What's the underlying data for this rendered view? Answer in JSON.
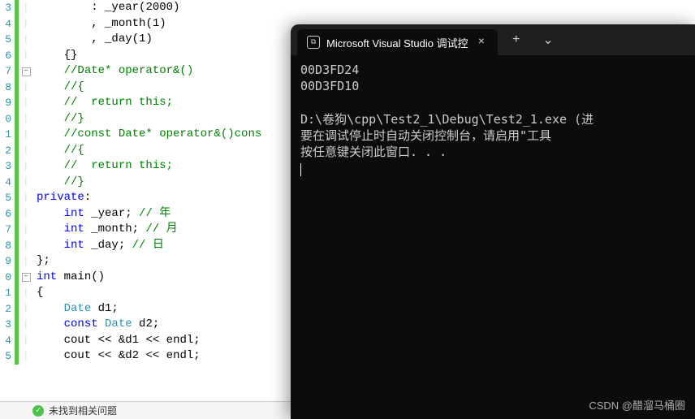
{
  "editor": {
    "lines": [
      {
        "num": "3",
        "fold": "",
        "code": [
          {
            "cls": "c-text",
            "t": "        "
          },
          {
            "cls": "c-punc",
            "t": ": "
          },
          {
            "cls": "c-text",
            "t": "_year"
          },
          {
            "cls": "c-punc",
            "t": "("
          },
          {
            "cls": "c-num",
            "t": "2000"
          },
          {
            "cls": "c-punc",
            "t": ")"
          }
        ]
      },
      {
        "num": "4",
        "fold": "",
        "code": [
          {
            "cls": "c-text",
            "t": "        "
          },
          {
            "cls": "c-punc",
            "t": ", "
          },
          {
            "cls": "c-text",
            "t": "_month"
          },
          {
            "cls": "c-punc",
            "t": "("
          },
          {
            "cls": "c-num",
            "t": "1"
          },
          {
            "cls": "c-punc",
            "t": ")"
          }
        ]
      },
      {
        "num": "5",
        "fold": "",
        "code": [
          {
            "cls": "c-text",
            "t": "        "
          },
          {
            "cls": "c-punc",
            "t": ", "
          },
          {
            "cls": "c-text",
            "t": "_day"
          },
          {
            "cls": "c-punc",
            "t": "("
          },
          {
            "cls": "c-num",
            "t": "1"
          },
          {
            "cls": "c-punc",
            "t": ")"
          }
        ]
      },
      {
        "num": "6",
        "fold": "",
        "code": [
          {
            "cls": "c-text",
            "t": "    "
          },
          {
            "cls": "c-punc",
            "t": "{}"
          }
        ]
      },
      {
        "num": "7",
        "fold": "box",
        "code": [
          {
            "cls": "c-text",
            "t": "    "
          },
          {
            "cls": "c-comment",
            "t": "//Date* operator&()"
          }
        ]
      },
      {
        "num": "8",
        "fold": "",
        "code": [
          {
            "cls": "c-text",
            "t": "    "
          },
          {
            "cls": "c-comment",
            "t": "//{"
          }
        ]
      },
      {
        "num": "9",
        "fold": "",
        "code": [
          {
            "cls": "c-text",
            "t": "    "
          },
          {
            "cls": "c-comment",
            "t": "//  return this;"
          }
        ]
      },
      {
        "num": "0",
        "fold": "",
        "code": [
          {
            "cls": "c-text",
            "t": "    "
          },
          {
            "cls": "c-comment",
            "t": "//}"
          }
        ]
      },
      {
        "num": "1",
        "fold": "",
        "code": [
          {
            "cls": "c-text",
            "t": "    "
          },
          {
            "cls": "c-comment",
            "t": "//const Date* operator&()cons"
          }
        ]
      },
      {
        "num": "2",
        "fold": "",
        "code": [
          {
            "cls": "c-text",
            "t": "    "
          },
          {
            "cls": "c-comment",
            "t": "//{"
          }
        ]
      },
      {
        "num": "3",
        "fold": "",
        "code": [
          {
            "cls": "c-text",
            "t": "    "
          },
          {
            "cls": "c-comment",
            "t": "//  return this;"
          }
        ]
      },
      {
        "num": "4",
        "fold": "",
        "code": [
          {
            "cls": "c-text",
            "t": "    "
          },
          {
            "cls": "c-comment",
            "t": "//}"
          }
        ]
      },
      {
        "num": "5",
        "fold": "",
        "code": [
          {
            "cls": "c-keyword",
            "t": "private"
          },
          {
            "cls": "c-punc",
            "t": ":"
          }
        ]
      },
      {
        "num": "6",
        "fold": "",
        "code": [
          {
            "cls": "c-text",
            "t": "    "
          },
          {
            "cls": "c-keyword",
            "t": "int"
          },
          {
            "cls": "c-text",
            "t": " _year; "
          },
          {
            "cls": "c-comment",
            "t": "// 年"
          }
        ]
      },
      {
        "num": "7",
        "fold": "",
        "code": [
          {
            "cls": "c-text",
            "t": "    "
          },
          {
            "cls": "c-keyword",
            "t": "int"
          },
          {
            "cls": "c-text",
            "t": " _month; "
          },
          {
            "cls": "c-comment",
            "t": "// 月"
          }
        ]
      },
      {
        "num": "8",
        "fold": "",
        "code": [
          {
            "cls": "c-text",
            "t": "    "
          },
          {
            "cls": "c-keyword",
            "t": "int"
          },
          {
            "cls": "c-text",
            "t": " _day; "
          },
          {
            "cls": "c-comment",
            "t": "// 日"
          }
        ]
      },
      {
        "num": "9",
        "fold": "",
        "code": [
          {
            "cls": "c-punc",
            "t": "};"
          }
        ]
      },
      {
        "num": "0",
        "fold": "box",
        "code": [
          {
            "cls": "c-keyword",
            "t": "int"
          },
          {
            "cls": "c-text",
            "t": " main"
          },
          {
            "cls": "c-punc",
            "t": "()"
          }
        ]
      },
      {
        "num": "1",
        "fold": "",
        "code": [
          {
            "cls": "c-punc",
            "t": "{"
          }
        ]
      },
      {
        "num": "2",
        "fold": "",
        "code": [
          {
            "cls": "c-text",
            "t": "    "
          },
          {
            "cls": "c-type",
            "t": "Date"
          },
          {
            "cls": "c-text",
            "t": " d1;"
          }
        ]
      },
      {
        "num": "3",
        "fold": "",
        "code": [
          {
            "cls": "c-text",
            "t": "    "
          },
          {
            "cls": "c-keyword",
            "t": "const"
          },
          {
            "cls": "c-text",
            "t": " "
          },
          {
            "cls": "c-type",
            "t": "Date"
          },
          {
            "cls": "c-text",
            "t": " d2;"
          }
        ]
      },
      {
        "num": "4",
        "fold": "",
        "code": [
          {
            "cls": "c-text",
            "t": "    cout "
          },
          {
            "cls": "c-punc",
            "t": "<<"
          },
          {
            "cls": "c-text",
            "t": " "
          },
          {
            "cls": "c-punc",
            "t": "&"
          },
          {
            "cls": "c-text",
            "t": "d1 "
          },
          {
            "cls": "c-punc",
            "t": "<<"
          },
          {
            "cls": "c-text",
            "t": " endl;"
          }
        ]
      },
      {
        "num": "5",
        "fold": "",
        "code": [
          {
            "cls": "c-text",
            "t": "    cout "
          },
          {
            "cls": "c-punc",
            "t": "<<"
          },
          {
            "cls": "c-text",
            "t": " "
          },
          {
            "cls": "c-punc",
            "t": "&"
          },
          {
            "cls": "c-text",
            "t": "d2 "
          },
          {
            "cls": "c-punc",
            "t": "<<"
          },
          {
            "cls": "c-text",
            "t": " endl;"
          }
        ]
      }
    ]
  },
  "status": {
    "text": "未找到相关问题"
  },
  "terminal": {
    "tab_icon": "⧉",
    "title": "Microsoft Visual Studio 调试控",
    "close": "×",
    "new_tab": "+",
    "dropdown": "⌄",
    "output": "00D3FD24\n00D3FD10\n\nD:\\卷狗\\cpp\\Test2_1\\Debug\\Test2_1.exe (进\n要在调试停止时自动关闭控制台，请启用\"工具\n按任意键关闭此窗口. . ."
  },
  "watermark": "CSDN @醋溜马桶圈"
}
